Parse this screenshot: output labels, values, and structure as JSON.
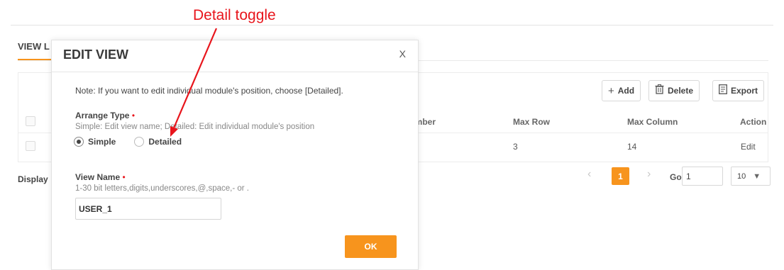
{
  "annotation": {
    "label": "Detail toggle",
    "color": "#e8151c"
  },
  "background": {
    "tab_label": "VIEW LIST",
    "toolbar": {
      "add_label": "Add",
      "delete_label": "Delete",
      "export_label": "Export"
    },
    "columns": [
      "Number",
      "Max Row",
      "Max Column",
      "Action"
    ],
    "row": {
      "max_row": "3",
      "max_column": "14",
      "action": "Edit"
    },
    "display_label": "Display",
    "pagination": {
      "current_page": "1",
      "go_label": "Go",
      "go_value": "1",
      "page_size": "10"
    },
    "accent_color": "#f7941d"
  },
  "modal": {
    "title": "EDIT VIEW",
    "close": "X",
    "note": "Note:   If you want to edit individual module's position, choose [Detailed].",
    "arrange_type": {
      "label": "Arrange Type",
      "hint": "Simple: Edit view name; Detailed: Edit individual module's position",
      "options": [
        "Simple",
        "Detailed"
      ],
      "selected": "Simple"
    },
    "view_name": {
      "label": "View Name",
      "hint": "1-30 bit letters,digits,underscores,@,space,- or .",
      "value": "USER_1"
    },
    "ok_label": "OK",
    "required_mark": "•"
  }
}
